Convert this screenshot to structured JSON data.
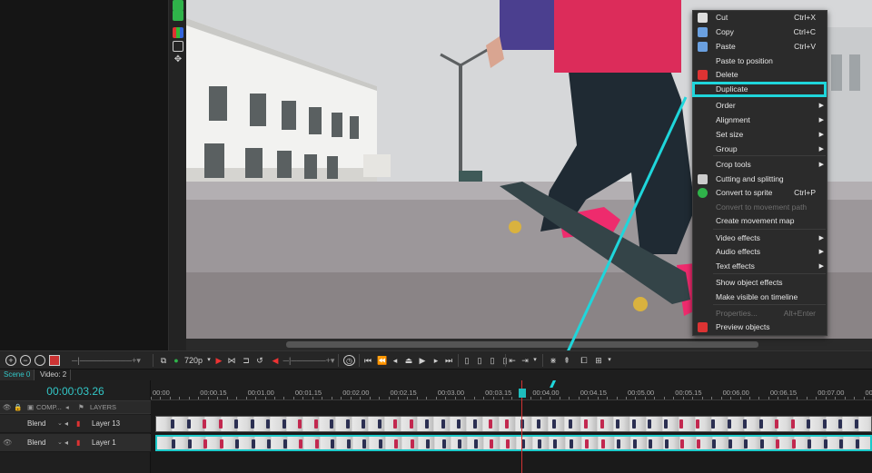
{
  "context_menu": {
    "items": [
      {
        "label": "Cut",
        "shortcut": "Ctrl+X",
        "icon": "scissors-icon",
        "disabled": false,
        "submenu": false
      },
      {
        "label": "Copy",
        "shortcut": "Ctrl+C",
        "icon": "copy-icon",
        "disabled": false,
        "submenu": false
      },
      {
        "label": "Paste",
        "shortcut": "Ctrl+V",
        "icon": "paste-icon",
        "disabled": false,
        "submenu": false
      },
      {
        "label": "Paste to position",
        "shortcut": "",
        "icon": "",
        "disabled": false,
        "submenu": false
      },
      {
        "label": "Delete",
        "shortcut": "",
        "icon": "trash-icon",
        "disabled": false,
        "submenu": false
      },
      {
        "label": "Duplicate",
        "shortcut": "",
        "icon": "",
        "disabled": false,
        "submenu": false
      },
      {
        "label": "Order",
        "shortcut": "",
        "icon": "",
        "disabled": false,
        "submenu": true
      },
      {
        "label": "Alignment",
        "shortcut": "",
        "icon": "",
        "disabled": false,
        "submenu": true
      },
      {
        "label": "Set size",
        "shortcut": "",
        "icon": "",
        "disabled": false,
        "submenu": true
      },
      {
        "label": "Group",
        "shortcut": "",
        "icon": "",
        "disabled": false,
        "submenu": true
      },
      {
        "label": "Crop tools",
        "shortcut": "",
        "icon": "",
        "disabled": false,
        "submenu": true
      },
      {
        "label": "Cutting and splitting",
        "shortcut": "",
        "icon": "knife-icon",
        "disabled": false,
        "submenu": false
      },
      {
        "label": "Convert to sprite",
        "shortcut": "Ctrl+P",
        "icon": "sprite-icon",
        "disabled": false,
        "submenu": false
      },
      {
        "label": "Convert to movement path",
        "shortcut": "",
        "icon": "",
        "disabled": true,
        "submenu": false
      },
      {
        "label": "Create movement map",
        "shortcut": "",
        "icon": "",
        "disabled": false,
        "submenu": false
      },
      {
        "label": "Video effects",
        "shortcut": "",
        "icon": "",
        "disabled": false,
        "submenu": true
      },
      {
        "label": "Audio effects",
        "shortcut": "",
        "icon": "",
        "disabled": false,
        "submenu": true
      },
      {
        "label": "Text effects",
        "shortcut": "",
        "icon": "",
        "disabled": false,
        "submenu": true
      },
      {
        "label": "Show object effects",
        "shortcut": "",
        "icon": "",
        "disabled": false,
        "submenu": false
      },
      {
        "label": "Make visible on timeline",
        "shortcut": "",
        "icon": "",
        "disabled": false,
        "submenu": false
      },
      {
        "label": "Properties...",
        "shortcut": "Alt+Enter",
        "icon": "",
        "disabled": true,
        "submenu": false
      },
      {
        "label": "Preview objects",
        "shortcut": "",
        "icon": "preview-objects-icon",
        "disabled": false,
        "submenu": false
      }
    ],
    "highlighted": "Duplicate",
    "highlight_color": "#1fd6db"
  },
  "toolbar": {
    "resolution": "720p"
  },
  "tabs": [
    {
      "label": "Scene 0"
    },
    {
      "label": "Video: 2"
    }
  ],
  "timeline": {
    "timecode": "00:00:03.26",
    "header": {
      "comp": "COMP...",
      "layers": "LAYERS"
    },
    "layers": [
      {
        "blend": "Blend",
        "name": "Layer 13"
      },
      {
        "blend": "Blend",
        "name": "Layer 1"
      }
    ],
    "ruler_labels": [
      "00:00",
      "00:00.15",
      "00:01.00",
      "00:01.15",
      "00:02.00",
      "00:02.15",
      "00:03.00",
      "00:03.15",
      "00:04.00",
      "00:04.15",
      "00:05.00",
      "00:05.15",
      "00:06.00",
      "00:06.15",
      "00:07.00",
      "00:07."
    ]
  },
  "colors": {
    "accent": "#1fd6db",
    "timecode": "#32c7c7",
    "playhead": "#d23333"
  }
}
